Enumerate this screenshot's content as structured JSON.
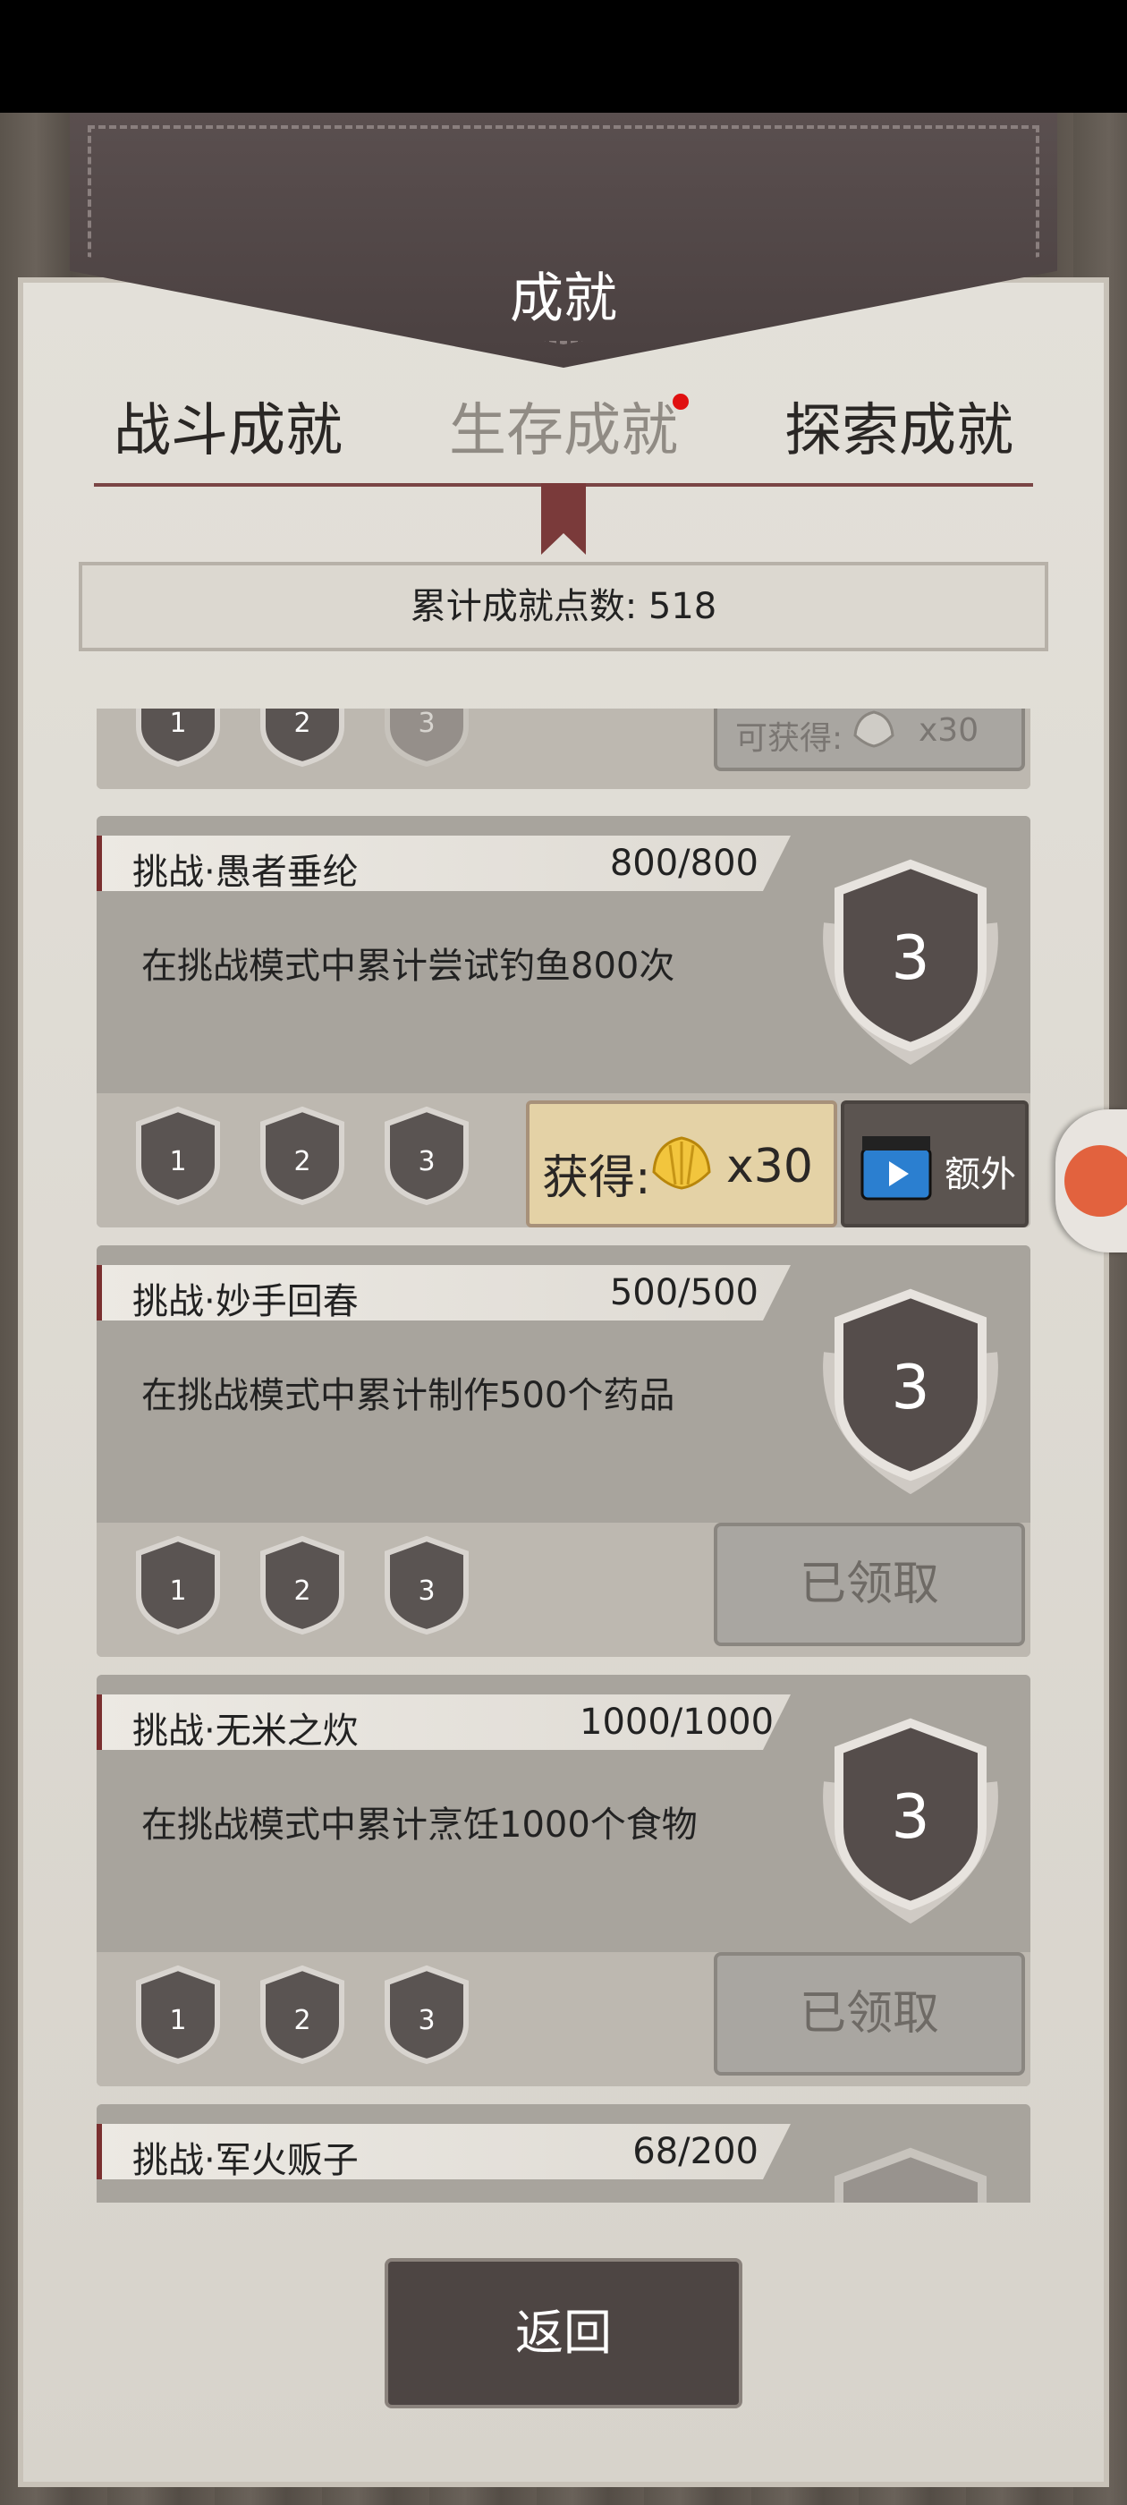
{
  "header": {
    "title": "成就"
  },
  "tabs": [
    {
      "label": "战斗成就"
    },
    {
      "label": "生存成就",
      "active": true,
      "has_dot": true
    },
    {
      "label": "探索成就"
    }
  ],
  "points": {
    "text": "累计成就点数: 518"
  },
  "partial_card": {
    "badges": [
      "1",
      "2",
      "3"
    ],
    "reward_text": "可获得:",
    "reward_amount": "x30"
  },
  "cards": [
    {
      "name": "挑战·愚者垂纶",
      "progress": "800/800",
      "description": "在挑战模式中累计尝试钓鱼800次",
      "level": "3",
      "badges": [
        "1",
        "2",
        "3"
      ],
      "reward_label": "获得:",
      "reward_amount": "x30",
      "extra_label": "额外"
    },
    {
      "name": "挑战·妙手回春",
      "progress": "500/500",
      "description": "在挑战模式中累计制作500个药品",
      "level": "3",
      "badges": [
        "1",
        "2",
        "3"
      ],
      "claimed_label": "已领取"
    },
    {
      "name": "挑战·无米之炊",
      "progress": "1000/1000",
      "description": "在挑战模式中累计烹饪1000个食物",
      "level": "3",
      "badges": [
        "1",
        "2",
        "3"
      ],
      "claimed_label": "已领取"
    },
    {
      "name": "挑战·军火贩子",
      "progress": "68/200"
    }
  ],
  "footer": {
    "back_label": "返回"
  },
  "colors": {
    "accent_red": "#7a3030",
    "gold": "#e4d2a6"
  }
}
